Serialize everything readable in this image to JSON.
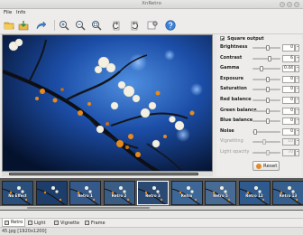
{
  "window": {
    "title": "XnRetro"
  },
  "menu": {
    "file": "File",
    "info": "Info"
  },
  "toolbar": {
    "items": [
      "open-folder-icon",
      "save-icon",
      "share-icon",
      "zoom-in-icon",
      "zoom-out-icon",
      "zoom-fit-icon",
      "rotate-left-icon",
      "rotate-right-icon",
      "settings-icon",
      "help-icon"
    ]
  },
  "panel": {
    "square_output": "Square output",
    "adjustments": [
      {
        "label": "Brightness",
        "value": "0",
        "level": 0.55,
        "enabled": true
      },
      {
        "label": "Contrast",
        "value": "6",
        "level": 0.62,
        "enabled": true
      },
      {
        "label": "Gamma",
        "value": "0.44",
        "level": 0.3,
        "enabled": true
      },
      {
        "label": "Exposure",
        "value": "0",
        "level": 0.55,
        "enabled": true
      },
      {
        "label": "Saturation",
        "value": "0",
        "level": 0.55,
        "enabled": true
      },
      {
        "label": "Red balance",
        "value": "0",
        "level": 0.55,
        "enabled": true
      },
      {
        "label": "Green balance",
        "value": "0",
        "level": 0.55,
        "enabled": true
      },
      {
        "label": "Blue balance",
        "value": "0",
        "level": 0.55,
        "enabled": true
      },
      {
        "label": "Noise",
        "value": "0",
        "level": 0.04,
        "enabled": true
      },
      {
        "label": "Vignetting",
        "value": "10",
        "level": 0.4,
        "enabled": false
      },
      {
        "label": "Light opacity",
        "value": "70",
        "level": 0.55,
        "enabled": false
      }
    ],
    "reset": "Reset"
  },
  "filmstrip": {
    "thumbnails": [
      {
        "label": "No Effect",
        "tint": "#2a4f7a",
        "selected": false
      },
      {
        "label": "",
        "tint": "#1d3e6a",
        "selected": false
      },
      {
        "label": "Retro 1",
        "tint": "#34598a",
        "selected": false
      },
      {
        "label": "Retro 2",
        "tint": "#3a5d86",
        "selected": false
      },
      {
        "label": "Retro 3",
        "tint": "#2a4a74",
        "selected": true
      },
      {
        "label": "Retro",
        "tint": "#3c6796",
        "selected": false
      },
      {
        "label": "Retro 5",
        "tint": "#486b93",
        "selected": false
      },
      {
        "label": "Retro 12",
        "tint": "#2e5a8e",
        "selected": false
      },
      {
        "label": "Retro 13",
        "tint": "#375f8d",
        "selected": false
      }
    ]
  },
  "tabs": [
    {
      "label": "Retro",
      "active": true
    },
    {
      "label": "Light",
      "active": false
    },
    {
      "label": "Vignette",
      "active": false
    },
    {
      "label": "Frame",
      "active": false
    }
  ],
  "status": {
    "text": "45.jpg [1920x1200]"
  }
}
